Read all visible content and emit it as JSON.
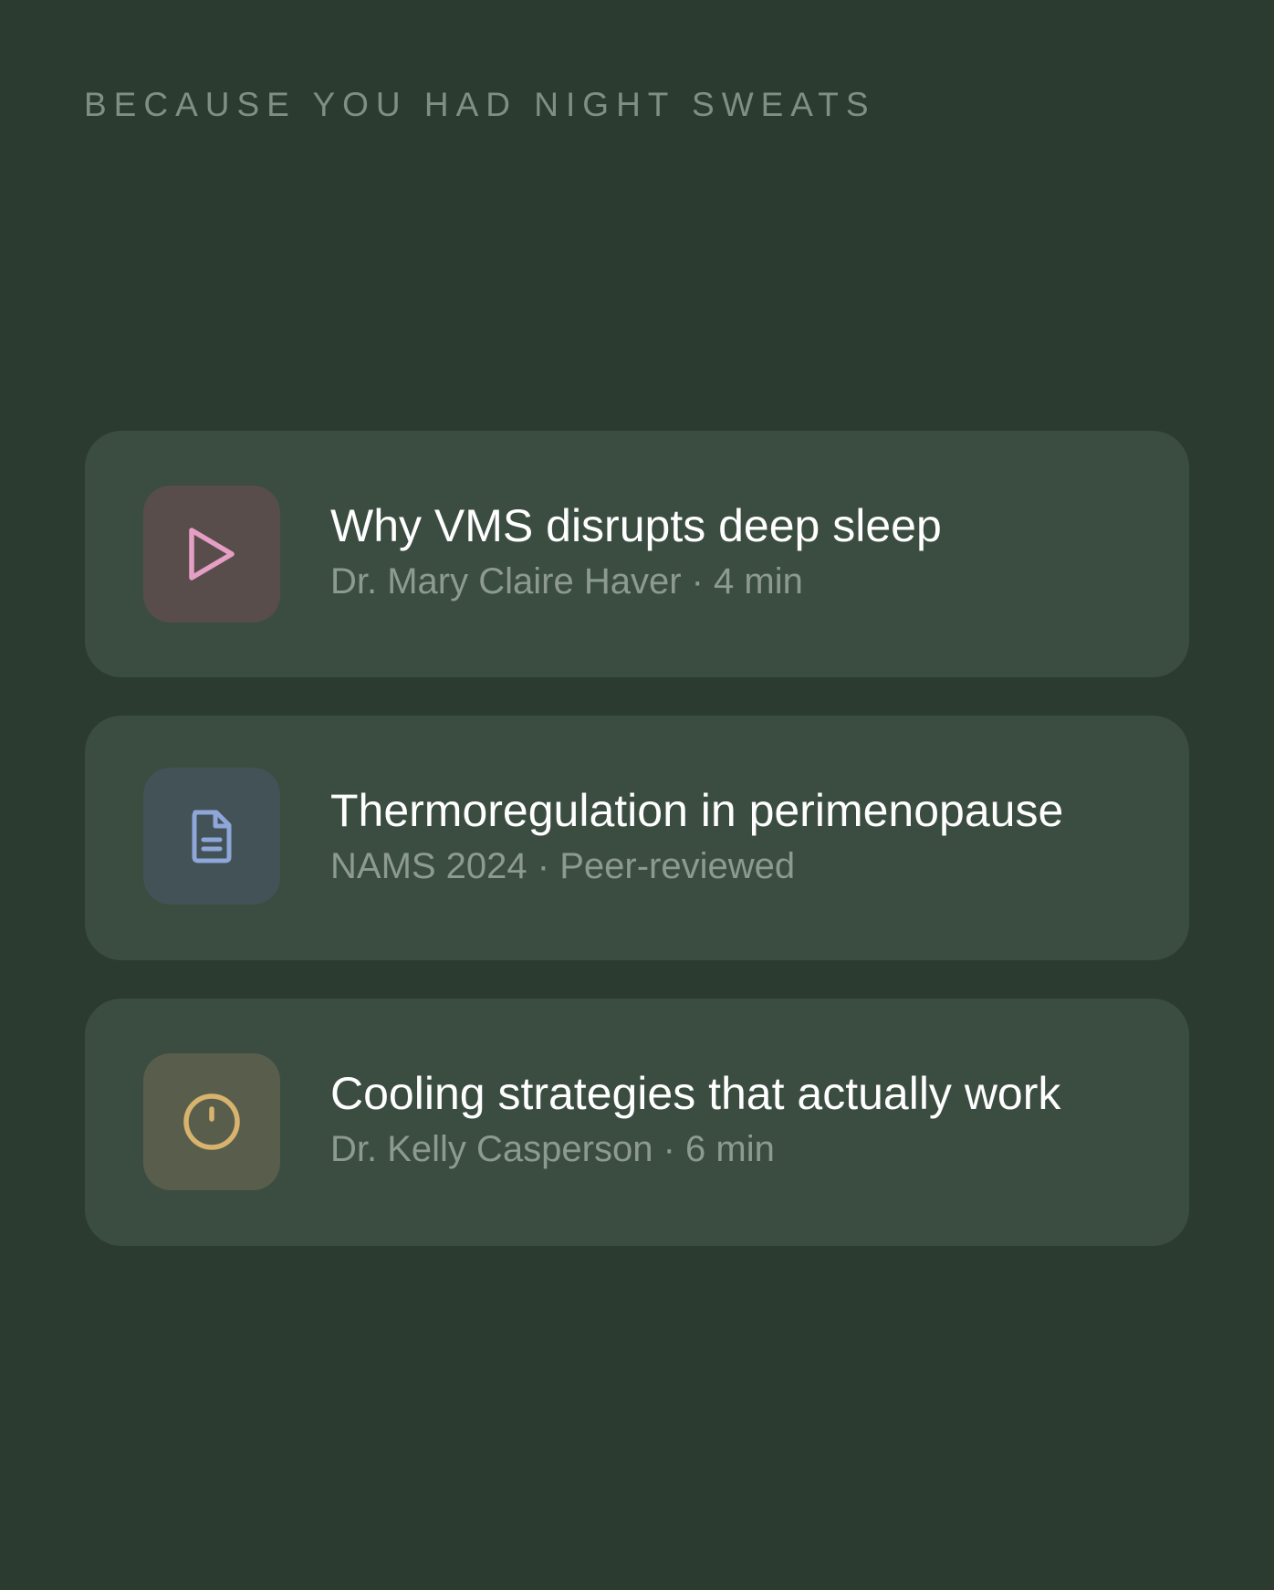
{
  "section": {
    "heading": "BECAUSE YOU HAD NIGHT SWEATS"
  },
  "cards": [
    {
      "title": "Why VMS disrupts deep sleep",
      "meta": "Dr. Mary Claire Haver · 4 min",
      "icon": "play-icon",
      "tile_color": "#584d4b",
      "icon_color": "#e59ec4"
    },
    {
      "title": "Thermoregulation in perimenopause",
      "meta": "NAMS 2024 · Peer-reviewed",
      "icon": "document-icon",
      "tile_color": "#425257",
      "icon_color": "#8ea6d8"
    },
    {
      "title": "Cooling strategies that actually work",
      "meta": "Dr. Kelly Casperson · 6 min",
      "icon": "clock-icon",
      "tile_color": "#585e4b",
      "icon_color": "#d8b36e"
    }
  ]
}
